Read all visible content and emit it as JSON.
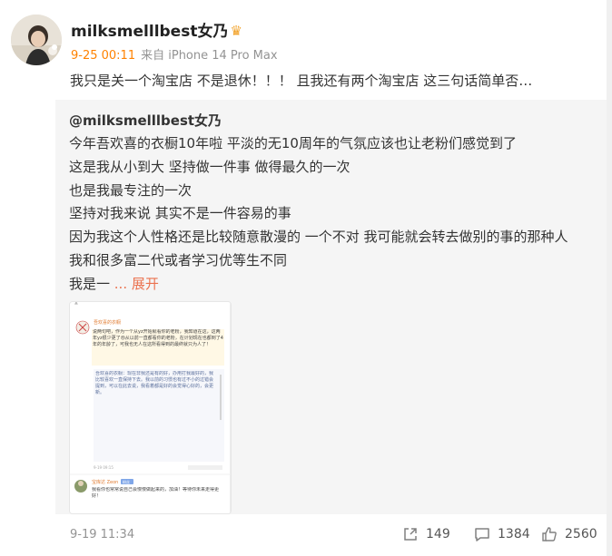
{
  "user": {
    "name": "milksmelllbest女乃",
    "crown_icon": "crown-icon",
    "time": "9-25 00:11",
    "source": "来自 iPhone 14 Pro Max"
  },
  "post": {
    "text": "我只是关一个淘宝店  不是退休！！！  且我还有两个淘宝店    这三句话简单否…"
  },
  "repost": {
    "author": "@milksmelllbest女乃",
    "lines": [
      "今年吾欢喜的衣橱10年啦 平淡的无10周年的气氛应该也让老粉们感觉到了",
      "这是我从小到大 坚持做一件事 做得最久的一次",
      "也是我最专注的一次",
      "坚持对我来说 其实不是一件容易的事",
      "因为我这个人性格还是比较随意散漫的 一个不对 我可能就会转去做别的事的那种人",
      "我和很多富二代或者学习优等生不同",
      "我是一 "
    ],
    "expand_label": "... 展开",
    "time": "9-19 11:34",
    "actions": {
      "share_count": "149",
      "comment_count": "1384",
      "like_count": "2560"
    }
  },
  "thumbnail": {
    "header_name": "吾欢喜的衣橱",
    "quote_block": "说两句吧，作为一个从yz开始就看你的老粉，我知道在这，这两年yz很少更了😢从以前一直都看你的老粉，在计划现在也都到了4年的年龄了，可我也无人在这所看得到的最终就只为人了！",
    "reply_lines": "吾欢喜的衣橱：现在非我还是有的好，办用打我最好的，我比较喜欢一直保持下去。我以前的习惯也有过不小的过错会提到，可以在此去说，我看着都是好的会觉得心好的，会更新。",
    "footer_name": "宝库达 Zeon",
    "footer_tag": "粉丝",
    "footer_text": "我看你也常常说自己会慢慢做起来的，加油！等待你未来走得更好！"
  },
  "colors": {
    "accent": "#ff8200",
    "expand": "#eb7350",
    "muted": "#939393",
    "repost_bg": "#f5f5f5"
  }
}
